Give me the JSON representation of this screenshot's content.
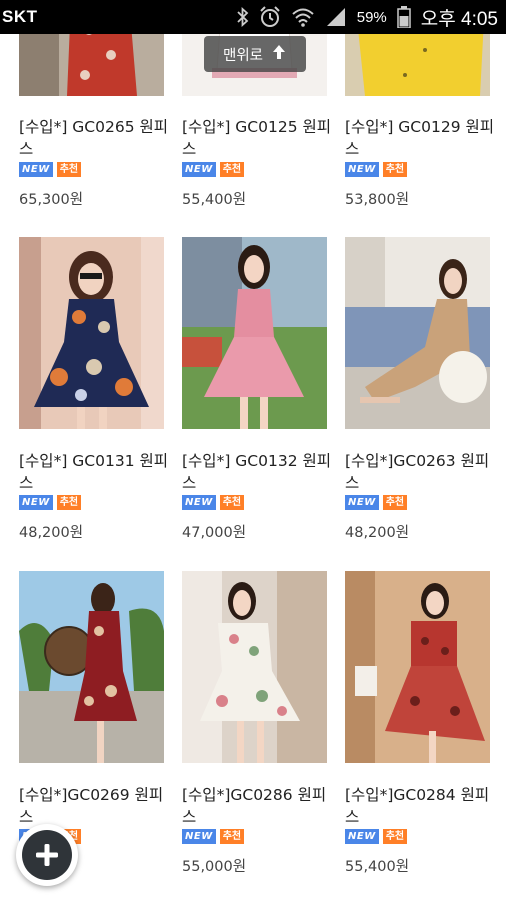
{
  "status_bar": {
    "carrier": "SKT",
    "battery_percent": "59%",
    "time": "오후 4:05"
  },
  "top_button": {
    "label": "맨위로",
    "icon": "arrow-up-icon"
  },
  "badges": {
    "new": "NEW",
    "recommend": "추천"
  },
  "products": [
    {
      "title": "[수입*] GC0265 원피스",
      "price": "65,300원"
    },
    {
      "title": "[수입*] GC0125 원피스",
      "price": "55,400원"
    },
    {
      "title": "[수입*] GC0129 원피스",
      "price": "53,800원"
    },
    {
      "title": "[수입*] GC0131 원피스",
      "price": "48,200원"
    },
    {
      "title": "[수입*] GC0132 원피스",
      "price": "47,000원"
    },
    {
      "title": "[수입*]GC0263 원피스",
      "price": "48,200원"
    },
    {
      "title": "[수입*]GC0269 원피스",
      "price": ""
    },
    {
      "title": "[수입*]GC0286 원피스",
      "price": "55,000원"
    },
    {
      "title": "[수입*]GC0284 원피스",
      "price": "55,400원"
    }
  ],
  "fab": {
    "icon": "plus-icon"
  },
  "colors": {
    "badge_new": "#4a86e8",
    "badge_recommend": "#ff7f27",
    "status_bar": "#000000"
  }
}
